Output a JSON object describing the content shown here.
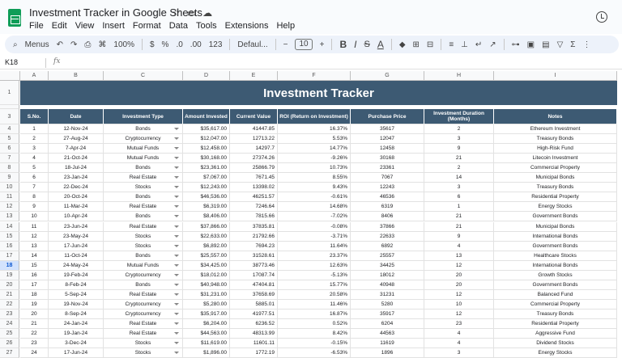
{
  "doc": {
    "title": "Investment Tracker in Google Sheets"
  },
  "menu": [
    "File",
    "Edit",
    "View",
    "Insert",
    "Format",
    "Data",
    "Tools",
    "Extensions",
    "Help"
  ],
  "toolbar": {
    "menus": "Menus",
    "zoom": "100%",
    "currency": "$",
    "percent": "%",
    "dec_dec": ".0",
    "dec_inc": ".00",
    "number": "123",
    "font": "Defaul...",
    "font_size": "10",
    "bold": "B",
    "italic": "I",
    "strike": "S",
    "text_color": "A"
  },
  "formula": {
    "cell_ref": "K18",
    "fx": "fx"
  },
  "columns": [
    "A",
    "B",
    "C",
    "D",
    "E",
    "F",
    "G",
    "H",
    "I"
  ],
  "sheet": {
    "banner": "Investment Tracker",
    "headers": [
      "S.No.",
      "Date",
      "Investment Type",
      "Amount Invested",
      "Current Value",
      "ROI (Return on Investment)",
      "Purchase Price",
      "Investment Duration (Months)",
      "Notes"
    ],
    "selected_row": "18",
    "rows": [
      [
        "1",
        "12-Nov-24",
        "Bonds",
        "$35,617.00",
        "41447.85",
        "16.37%",
        "35617",
        "2",
        "Ethereum Investment"
      ],
      [
        "2",
        "27-Aug-24",
        "Cryptocurrency",
        "$12,047.00",
        "12713.22",
        "5.53%",
        "12047",
        "3",
        "Treasury Bonds"
      ],
      [
        "3",
        "7-Apr-24",
        "Mutual Funds",
        "$12,458.00",
        "14297.7",
        "14.77%",
        "12458",
        "9",
        "High-Risk Fund"
      ],
      [
        "4",
        "21-Oct-24",
        "Mutual Funds",
        "$30,168.00",
        "27374.26",
        "-9.26%",
        "30168",
        "21",
        "Litecoin Investment"
      ],
      [
        "5",
        "18-Jul-24",
        "Bonds",
        "$23,361.00",
        "25866.79",
        "10.73%",
        "23361",
        "2",
        "Commercial Property"
      ],
      [
        "6",
        "23-Jan-24",
        "Real Estate",
        "$7,067.00",
        "7671.45",
        "8.55%",
        "7067",
        "14",
        "Municipal Bonds"
      ],
      [
        "7",
        "22-Dec-24",
        "Stocks",
        "$12,243.00",
        "13398.02",
        "9.43%",
        "12243",
        "3",
        "Treasury Bonds"
      ],
      [
        "8",
        "20-Oct-24",
        "Bonds",
        "$46,536.00",
        "46251.57",
        "-0.61%",
        "46536",
        "6",
        "Residential Property"
      ],
      [
        "9",
        "11-Mar-24",
        "Real Estate",
        "$6,319.00",
        "7246.64",
        "14.68%",
        "6319",
        "1",
        "Energy Stocks"
      ],
      [
        "10",
        "10-Apr-24",
        "Bonds",
        "$8,406.00",
        "7815.66",
        "-7.02%",
        "8406",
        "21",
        "Government Bonds"
      ],
      [
        "11",
        "23-Jun-24",
        "Real Estate",
        "$37,866.00",
        "37835.81",
        "-0.08%",
        "37866",
        "21",
        "Municipal Bonds"
      ],
      [
        "12",
        "23-May-24",
        "Stocks",
        "$22,633.00",
        "21792.66",
        "-3.71%",
        "22633",
        "9",
        "International Bonds"
      ],
      [
        "13",
        "17-Jun-24",
        "Stocks",
        "$6,892.00",
        "7694.23",
        "11.64%",
        "6892",
        "4",
        "Government Bonds"
      ],
      [
        "14",
        "11-Oct-24",
        "Bonds",
        "$25,557.00",
        "31528.61",
        "23.37%",
        "25557",
        "13",
        "Healthcare Stocks"
      ],
      [
        "15",
        "24-May-24",
        "Mutual Funds",
        "$34,425.00",
        "38773.46",
        "12.63%",
        "34425",
        "12",
        "International Bonds"
      ],
      [
        "16",
        "19-Feb-24",
        "Cryptocurrency",
        "$18,012.00",
        "17087.74",
        "-5.13%",
        "18012",
        "20",
        "Growth Stocks"
      ],
      [
        "17",
        "8-Feb-24",
        "Bonds",
        "$40,948.00",
        "47404.81",
        "15.77%",
        "40948",
        "20",
        "Government Bonds"
      ],
      [
        "18",
        "5-Sep-24",
        "Real Estate",
        "$31,231.00",
        "37658.69",
        "20.58%",
        "31231",
        "12",
        "Balanced Fund"
      ],
      [
        "19",
        "19-Nov-24",
        "Cryptocurrency",
        "$5,280.00",
        "5885.01",
        "11.46%",
        "5280",
        "10",
        "Commercial Property"
      ],
      [
        "20",
        "8-Sep-24",
        "Cryptocurrency",
        "$35,917.00",
        "41977.51",
        "16.87%",
        "35917",
        "12",
        "Treasury Bonds"
      ],
      [
        "21",
        "24-Jan-24",
        "Real Estate",
        "$6,204.00",
        "6236.52",
        "0.52%",
        "6204",
        "23",
        "Residential Property"
      ],
      [
        "22",
        "19-Jan-24",
        "Real Estate",
        "$44,563.00",
        "48313.99",
        "8.42%",
        "44563",
        "4",
        "Aggressive Fund"
      ],
      [
        "23",
        "3-Dec-24",
        "Stocks",
        "$11,619.00",
        "11601.11",
        "-0.15%",
        "11619",
        "4",
        "Dividend Stocks"
      ],
      [
        "24",
        "17-Jun-24",
        "Stocks",
        "$1,896.00",
        "1772.19",
        "-6.53%",
        "1896",
        "3",
        "Energy Stocks"
      ]
    ]
  }
}
